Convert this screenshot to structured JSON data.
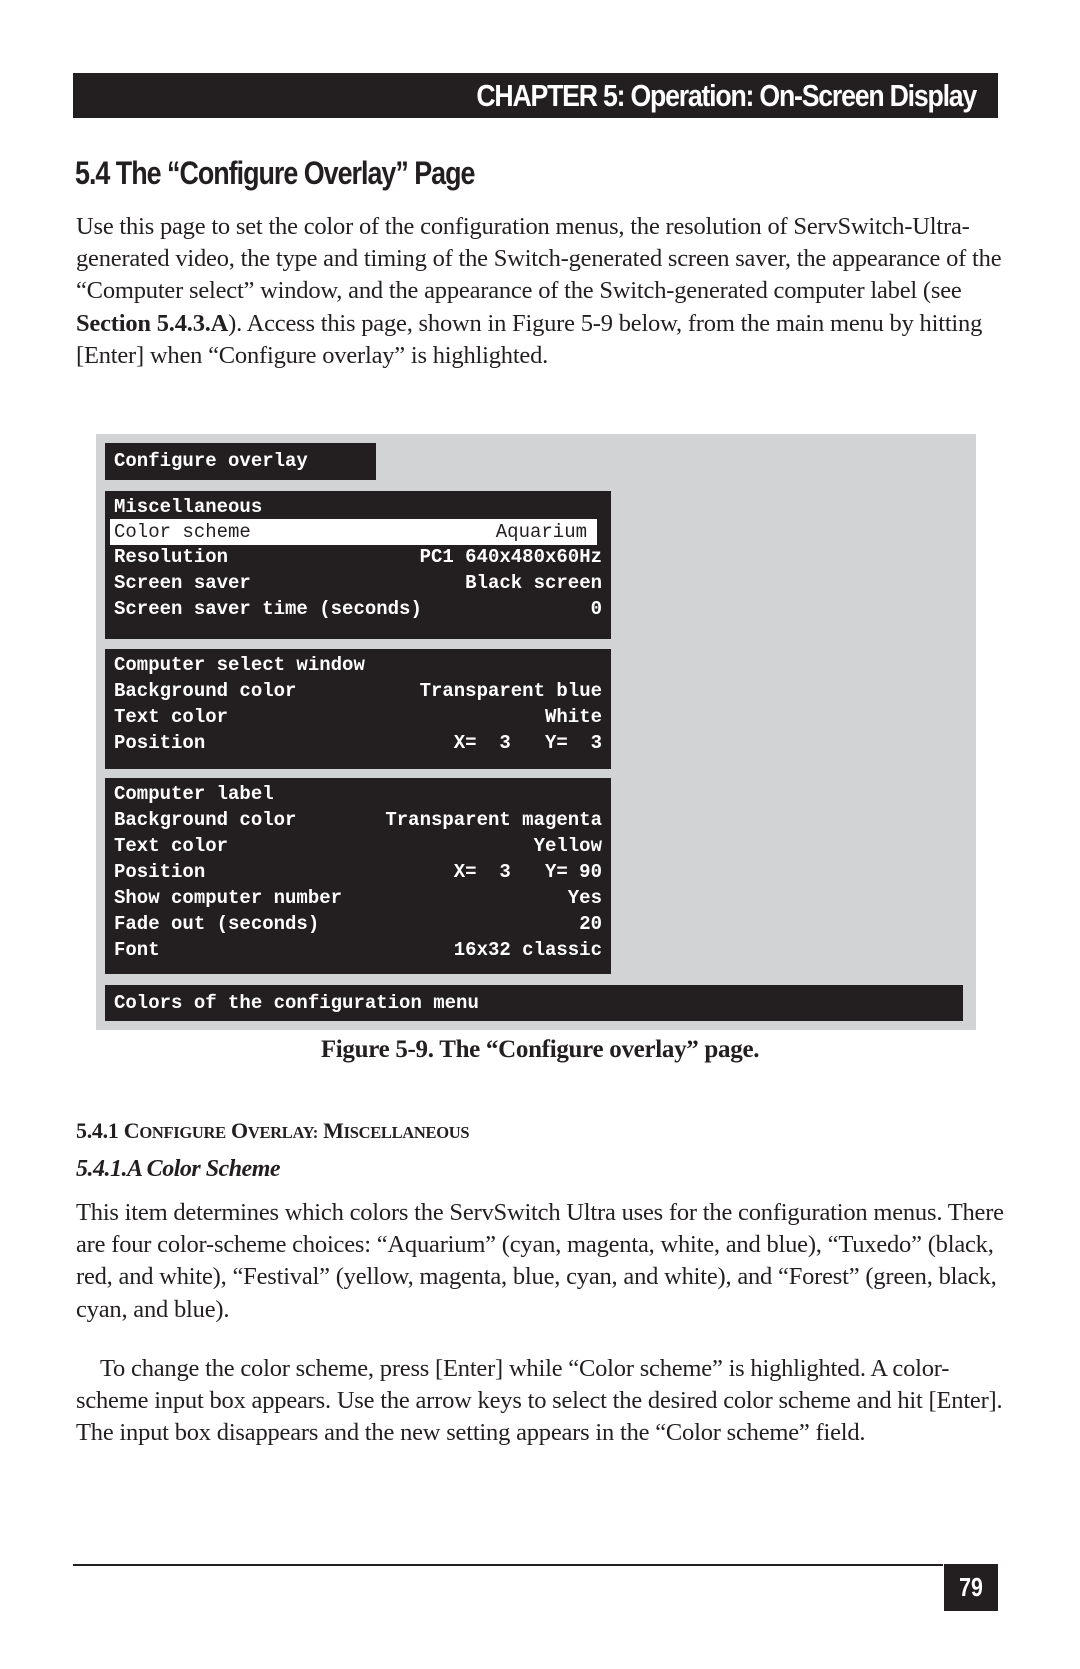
{
  "header": {
    "chapter_title": "CHAPTER 5: Operation: On-Screen Display"
  },
  "section": {
    "title": "5.4 The “Configure Overlay” Page",
    "intro_before_bold": "Use this page to set the color of the configuration menus, the resolution of ServSwitch-Ultra-generated video, the type and timing of the Switch-generated screen saver, the appearance of the “Computer select” window, and the appearance of the Switch-generated computer label (see ",
    "intro_bold": "Section 5.4.3.A",
    "intro_after_bold": "). Access this page, shown in Figure 5-9 below, from the main menu by hitting [Enter] when “Configure overlay” is highlighted."
  },
  "figure": {
    "screen_title": "Configure overlay",
    "miscellaneous": {
      "heading": "Miscellaneous",
      "rows": [
        {
          "label": "Color scheme",
          "value": "Aquarium",
          "highlighted": true
        },
        {
          "label": "Resolution",
          "value": "PC1 640x480x60Hz"
        },
        {
          "label": "Screen saver",
          "value": "Black screen"
        },
        {
          "label": "Screen saver time (seconds)",
          "value": "0"
        }
      ]
    },
    "computer_select_window": {
      "heading": "Computer select window",
      "rows": [
        {
          "label": "Background color",
          "value": "Transparent blue"
        },
        {
          "label": "Text color",
          "value": "White"
        },
        {
          "label": "Position",
          "value": "X=  3   Y=  3"
        }
      ]
    },
    "computer_label": {
      "heading": "Computer label",
      "rows": [
        {
          "label": "Background color",
          "value": "Transparent magenta"
        },
        {
          "label": "Text color",
          "value": "Yellow"
        },
        {
          "label": "Position",
          "value": "X=  3   Y= 90"
        },
        {
          "label": "Show computer number",
          "value": "Yes"
        },
        {
          "label": "Fade out (seconds)",
          "value": "20"
        },
        {
          "label": "Font",
          "value": "16x32 classic"
        }
      ]
    },
    "colors_menu": "Colors of the configuration menu",
    "caption": "Figure 5-9. The “Configure overlay” page."
  },
  "subsection": {
    "number": "5.4.1",
    "title_parts": [
      {
        "cap": "C",
        "rest": "ONFIGURE"
      },
      {
        "cap": "O",
        "rest": "VERLAY:"
      },
      {
        "cap": "M",
        "rest": "ISCELLANEOUS"
      }
    ],
    "subsubsection_title": "5.4.1.A Color Scheme",
    "para1": "This item determines which colors the ServSwitch Ultra uses for the configuration menus. There are four color-scheme choices: “Aquarium” (cyan, magenta, white, and blue), “Tuxedo” (black, red, and white), “Festival” (yellow, magenta, blue, cyan, and white), and “Forest” (green, black, cyan, and blue).",
    "para2": "To change the color scheme, press [Enter] while “Color scheme” is highlighted. A color-scheme input box appears. Use the arrow keys to select the desired color scheme and hit [Enter]. The input box disappears and the new setting appears in the “Color scheme” field."
  },
  "footer": {
    "page_number": "79"
  },
  "colors": {
    "ink": "#231f20",
    "figure_background": "#d1d3d4",
    "highlight": "#ffffff"
  }
}
